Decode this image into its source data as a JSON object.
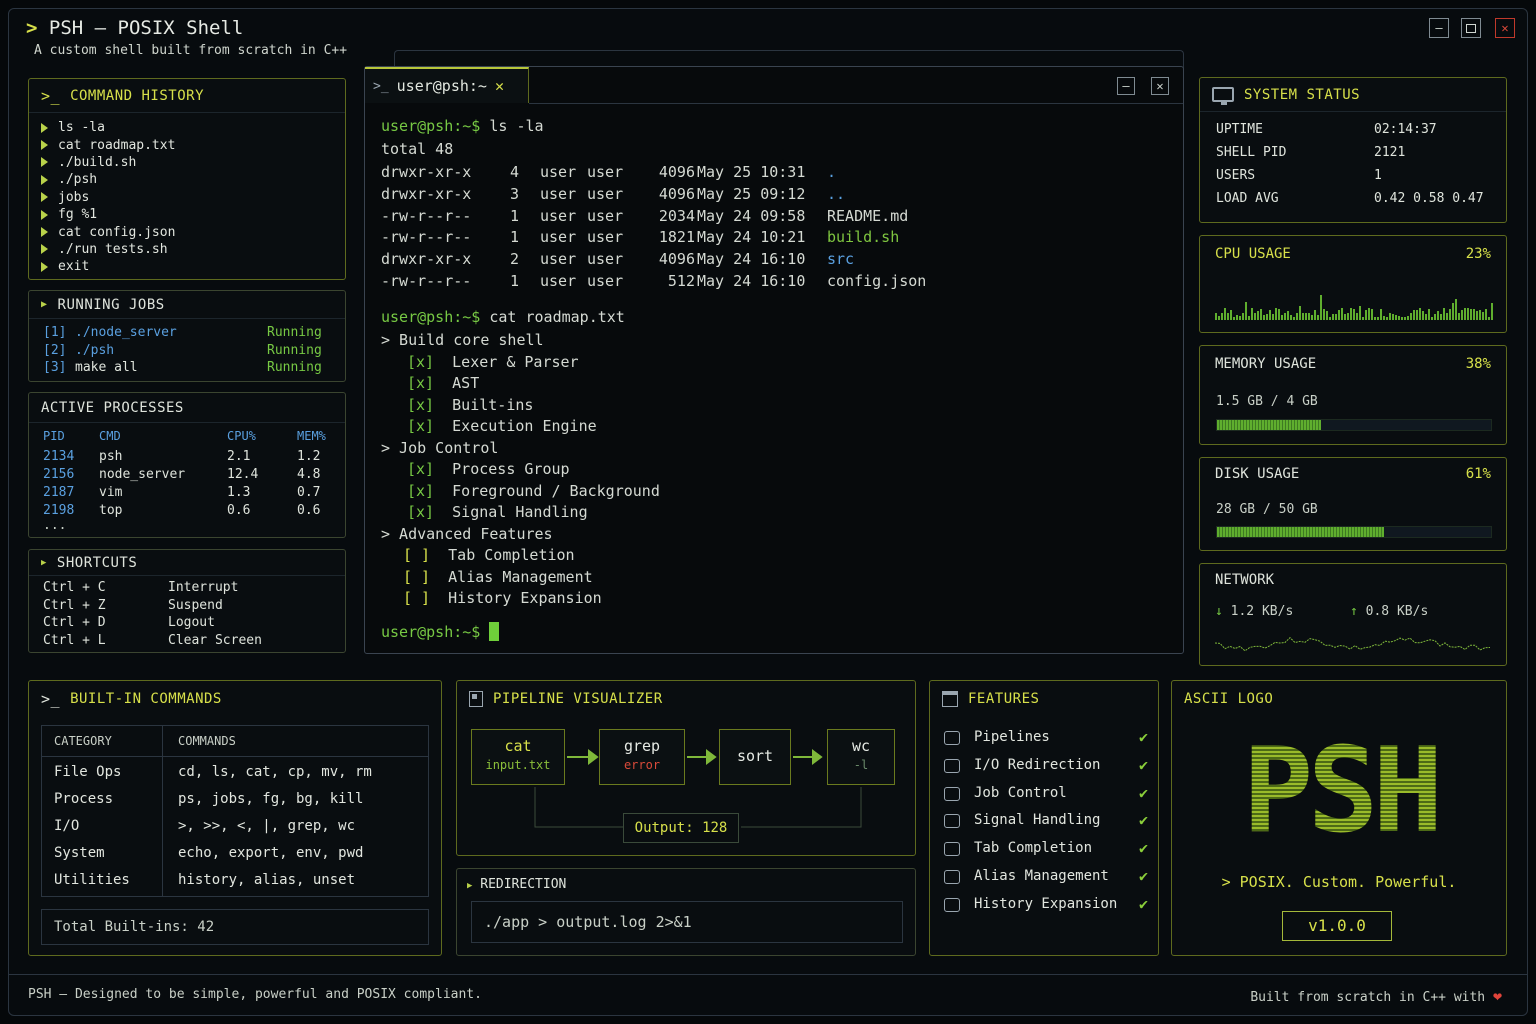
{
  "app": {
    "title": "PSH — POSIX Shell",
    "subtitle": "A custom shell built from scratch in C++"
  },
  "history": {
    "title": "COMMAND HISTORY",
    "items": [
      "ls -la",
      "cat roadmap.txt",
      "./build.sh",
      "./psh",
      "jobs",
      "fg %1",
      "cat config.json",
      "./run tests.sh",
      "exit"
    ]
  },
  "jobs": {
    "title": "RUNNING JOBS",
    "items": [
      {
        "id": "[1]",
        "cmd": "./node_server",
        "status": "Running"
      },
      {
        "id": "[2]",
        "cmd": "./psh",
        "status": "Running"
      },
      {
        "id": "[3]",
        "cmd": "make all",
        "status": "Running"
      }
    ]
  },
  "processes": {
    "title": "ACTIVE PROCESSES",
    "headers": [
      "PID",
      "CMD",
      "CPU%",
      "MEM%"
    ],
    "rows": [
      [
        "2134",
        "psh",
        "2.1",
        "1.2"
      ],
      [
        "2156",
        "node_server",
        "12.4",
        "4.8"
      ],
      [
        "2187",
        "vim",
        "1.3",
        "0.7"
      ],
      [
        "2198",
        "top",
        "0.6",
        "0.6"
      ]
    ],
    "more": "..."
  },
  "shortcuts": {
    "title": "SHORTCUTS",
    "items": [
      {
        "key": "Ctrl + C",
        "action": "Interrupt"
      },
      {
        "key": "Ctrl + Z",
        "action": "Suspend"
      },
      {
        "key": "Ctrl + D",
        "action": "Logout"
      },
      {
        "key": "Ctrl + L",
        "action": "Clear Screen"
      }
    ]
  },
  "terminal": {
    "tab": "user@psh:~",
    "prompt": "user@psh:~$",
    "cmd1": "ls -la",
    "total": "total 48",
    "listing": [
      {
        "perm": "drwxr-xr-x",
        "n": "4",
        "u": "user",
        "g": "user",
        "size": "4096",
        "date": "May 25 10:31",
        "name": ".",
        "kind": "dir"
      },
      {
        "perm": "drwxr-xr-x",
        "n": "3",
        "u": "user",
        "g": "user",
        "size": "4096",
        "date": "May 25 09:12",
        "name": "..",
        "kind": "dir"
      },
      {
        "perm": "-rw-r--r--",
        "n": "1",
        "u": "user",
        "g": "user",
        "size": "2034",
        "date": "May 24 09:58",
        "name": "README.md",
        "kind": "file"
      },
      {
        "perm": "-rw-r--r--",
        "n": "1",
        "u": "user",
        "g": "user",
        "size": "1821",
        "date": "May 24 10:21",
        "name": "build.sh",
        "kind": "exec"
      },
      {
        "perm": "drwxr-xr-x",
        "n": "2",
        "u": "user",
        "g": "user",
        "size": "4096",
        "date": "May 24 16:10",
        "name": "src",
        "kind": "dir"
      },
      {
        "perm": "-rw-r--r--",
        "n": "1",
        "u": "user",
        "g": "user",
        "size": "512",
        "date": "May 24 16:10",
        "name": "config.json",
        "kind": "file"
      }
    ],
    "cmd2": "cat roadmap.txt",
    "roadmap": [
      {
        "type": "section",
        "text": "> Build core shell"
      },
      {
        "type": "done",
        "mark": "[x]",
        "text": "Lexer & Parser"
      },
      {
        "type": "done",
        "mark": "[x]",
        "text": "AST"
      },
      {
        "type": "done",
        "mark": "[x]",
        "text": "Built-ins"
      },
      {
        "type": "done",
        "mark": "[x]",
        "text": "Execution Engine"
      },
      {
        "type": "section",
        "text": "> Job Control"
      },
      {
        "type": "done",
        "mark": "[x]",
        "text": "Process Group"
      },
      {
        "type": "done",
        "mark": "[x]",
        "text": "Foreground / Background"
      },
      {
        "type": "done",
        "mark": "[x]",
        "text": "Signal Handling"
      },
      {
        "type": "section",
        "text": "> Advanced Features"
      },
      {
        "type": "todo",
        "mark": "[ ]",
        "text": "Tab Completion"
      },
      {
        "type": "todo",
        "mark": "[ ]",
        "text": "Alias Management"
      },
      {
        "type": "todo",
        "mark": "[ ]",
        "text": "History Expansion"
      }
    ]
  },
  "status": {
    "title": "SYSTEM STATUS",
    "rows": [
      {
        "label": "UPTIME",
        "value": "02:14:37"
      },
      {
        "label": "SHELL PID",
        "value": "2121"
      },
      {
        "label": "USERS",
        "value": "1"
      },
      {
        "label": "LOAD AVG",
        "value": "0.42 0.58 0.47"
      }
    ]
  },
  "cpu": {
    "title": "CPU USAGE",
    "value": "23%"
  },
  "memory": {
    "title": "MEMORY USAGE",
    "value": "38%",
    "detail": "1.5 GB / 4 GB",
    "fraction": 0.38
  },
  "disk": {
    "title": "DISK USAGE",
    "value": "61%",
    "detail": "28 GB / 50 GB",
    "fraction": 0.61
  },
  "network": {
    "title": "NETWORK",
    "down": "1.2 KB/s",
    "up": "0.8 KB/s"
  },
  "builtins": {
    "title": "BUILT-IN COMMANDS",
    "headers": [
      "CATEGORY",
      "COMMANDS"
    ],
    "rows": [
      [
        "File Ops",
        "cd, ls, cat, cp, mv, rm"
      ],
      [
        "Process",
        "ps, jobs, fg, bg, kill"
      ],
      [
        "I/O",
        ">, >>, <, |, grep, wc"
      ],
      [
        "System",
        "echo, export, env, pwd"
      ],
      [
        "Utilities",
        "history, alias, unset"
      ]
    ],
    "total": "Total Built-ins: 42"
  },
  "pipeline": {
    "title": "PIPELINE VISUALIZER",
    "nodes": [
      {
        "name": "cat",
        "sub": "input.txt"
      },
      {
        "name": "grep",
        "sub": "error"
      },
      {
        "name": "sort",
        "sub": ""
      },
      {
        "name": "wc",
        "sub": "-l"
      }
    ],
    "output": "Output: 128"
  },
  "redirection": {
    "title": "REDIRECTION",
    "command": "./app > output.log 2>&1"
  },
  "features": {
    "title": "FEATURES",
    "items": [
      "Pipelines",
      "I/O Redirection",
      "Job Control",
      "Signal Handling",
      "Tab Completion",
      "Alias Management",
      "History Expansion"
    ]
  },
  "logo": {
    "title": "ASCII LOGO",
    "text": "PSH",
    "tagline": "> POSIX. Custom. Powerful.",
    "version": "v1.0.0"
  },
  "footer": {
    "left": "PSH — Designed to be simple, powerful and POSIX compliant.",
    "right": "Built from scratch in C++ with"
  }
}
